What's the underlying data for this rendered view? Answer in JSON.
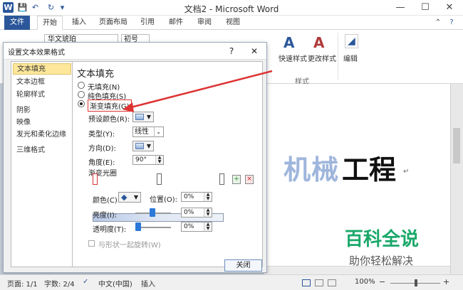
{
  "window": {
    "title": "文档2 - Microsoft Word",
    "quick_access": [
      "W",
      "💾",
      "↶",
      "↻",
      "▾"
    ],
    "controls": [
      "—",
      "☐",
      "✕"
    ]
  },
  "tabs": [
    "文件",
    "开始",
    "插入",
    "页面布局",
    "引用",
    "邮件",
    "审阅",
    "视图"
  ],
  "ribbon": {
    "font_name": "华文琥珀",
    "font_size": "初号",
    "styles_label": "样式",
    "styles_buttons": [
      "快速样式",
      "更改样式"
    ],
    "edit_label": "编辑"
  },
  "dialog": {
    "title": "设置文本效果格式",
    "help": "?",
    "close_x": "✕",
    "categories": [
      "文本填充",
      "文本边框",
      "轮廓样式",
      "阴影",
      "映像",
      "发光和柔化边缘",
      "三维格式"
    ],
    "selected_category": "文本填充",
    "panel": {
      "heading": "文本填充",
      "options": [
        "无填充(N)",
        "纯色填充(S)",
        "渐变填充(G)"
      ],
      "selected_option": "渐变填充(G)",
      "preset_label": "预设颜色(R):",
      "type_label": "类型(Y):",
      "type_value": "线性",
      "direction_label": "方向(D):",
      "angle_label": "角度(E):",
      "angle_value": "90°",
      "stops_label": "渐变光圈",
      "color_label": "颜色(C)",
      "position_label": "位置(O):",
      "position_value": "0%",
      "brightness_label": "亮度(I):",
      "brightness_value": "0%",
      "transparency_label": "透明度(T):",
      "transparency_value": "0%",
      "rotate_label": "与形状一起旋转(W)"
    },
    "close_button": "关闭"
  },
  "document": {
    "text_gradient": "机械",
    "text_solid": "工程",
    "mark": "↵"
  },
  "watermark": {
    "title": "百科全说",
    "subtitle": "助你轻松解决"
  },
  "statusbar": {
    "page": "页面: 1/1",
    "words": "字数: 2/4",
    "language": "中文(中国)",
    "mode": "插入",
    "zoom": "100%",
    "zoom_minus": "−",
    "zoom_plus": "+"
  }
}
